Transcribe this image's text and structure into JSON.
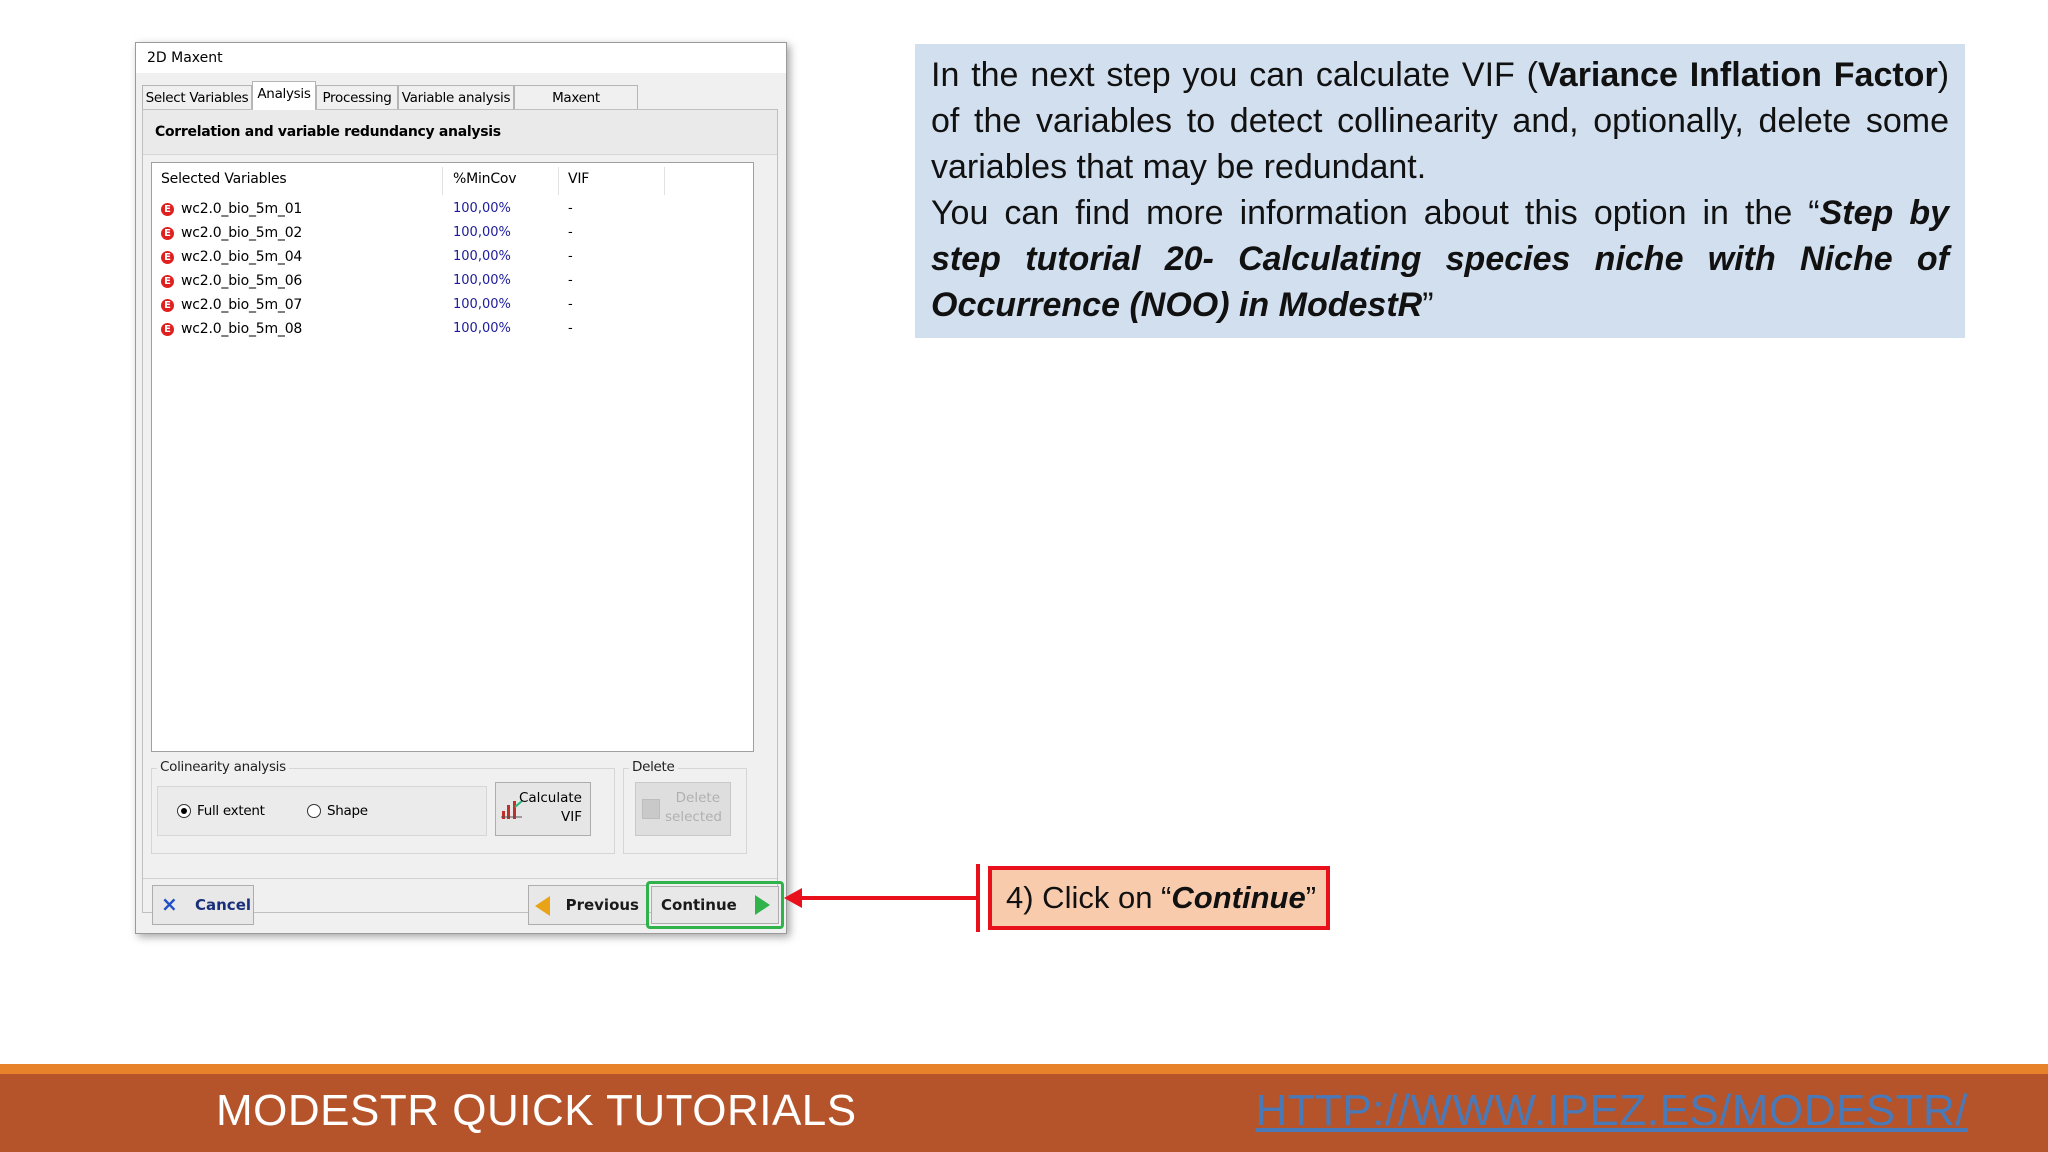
{
  "window": {
    "title": "2D Maxent",
    "tabs": [
      "Select Variables",
      "Analysis",
      "Processing",
      "Variable analysis",
      "Maxent parameters"
    ],
    "active_tab": "Analysis"
  },
  "panel": {
    "header": "Correlation and variable redundancy analysis",
    "list": {
      "columns": [
        "Selected Variables",
        "%MinCov",
        "VIF"
      ],
      "rows": [
        {
          "name": "wc2.0_bio_5m_01",
          "mincov": "100,00%",
          "vif": "-"
        },
        {
          "name": "wc2.0_bio_5m_02",
          "mincov": "100,00%",
          "vif": "-"
        },
        {
          "name": "wc2.0_bio_5m_04",
          "mincov": "100,00%",
          "vif": "-"
        },
        {
          "name": "wc2.0_bio_5m_06",
          "mincov": "100,00%",
          "vif": "-"
        },
        {
          "name": "wc2.0_bio_5m_07",
          "mincov": "100,00%",
          "vif": "-"
        },
        {
          "name": "wc2.0_bio_5m_08",
          "mincov": "100,00%",
          "vif": "-"
        }
      ],
      "row_icon_glyph": "E"
    },
    "collinearity": {
      "label": "Colinearity analysis",
      "option_full": "Full extent",
      "option_shape": "Shape",
      "selected": "full",
      "calculate_line1": "Calculate",
      "calculate_line2": "VIF"
    },
    "delete": {
      "label": "Delete",
      "button_line1": "Delete",
      "button_line2": "selected"
    }
  },
  "buttons": {
    "cancel": "Cancel",
    "cancel_glyph": "×",
    "previous": "Previous",
    "continue": "Continue"
  },
  "info": {
    "p1_a": "In the next step you can calculate VIF (",
    "p1_bold": "Variance Inflation Factor",
    "p1_b": ") of the variables to detect collinearity and, optionally, delete some variables that may be redundant.",
    "p2_a": "You can find more information about this option in the “",
    "p2_bold": "Step by step tutorial 20- Calculating species niche with Niche of Occurrence (NOO) in ModestR",
    "p2_b": "”"
  },
  "callout": {
    "prefix": "4) Click on “",
    "bold": "Continue",
    "suffix": "”"
  },
  "footer": {
    "title": "MODESTR QUICK TUTORIALS",
    "link": "HTTP://WWW.IPEZ.ES/MODESTR/"
  },
  "colors": {
    "info_bg": "#d2dfee",
    "callout_bg": "#f8cbad",
    "callout_border": "#e8101a",
    "highlight_green": "#2fb34a",
    "footer_bg": "#b5532a",
    "footer_line": "#e8822a",
    "link": "#4a79b8"
  }
}
